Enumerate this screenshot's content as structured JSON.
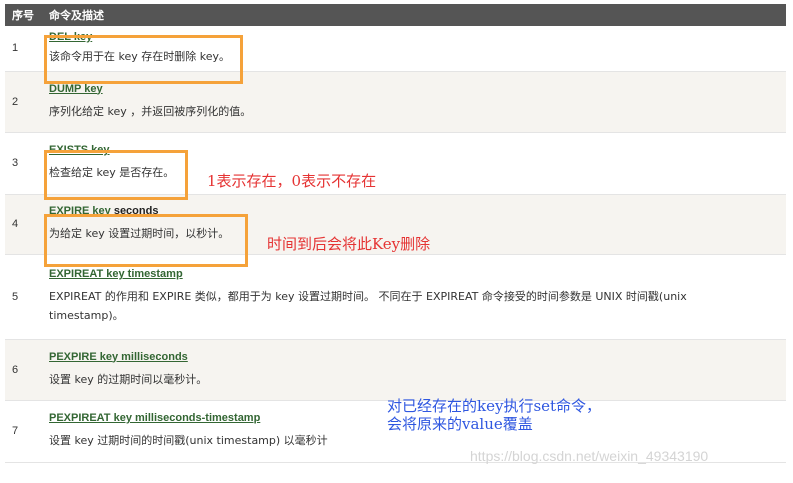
{
  "header": {
    "col_index": "序号",
    "col_command": "命令及描述"
  },
  "rows": [
    {
      "index": "1",
      "command": "DEL key",
      "args": "",
      "description": "该命令用于在 key 存在时删除 key。"
    },
    {
      "index": "2",
      "command": "DUMP key",
      "args": "",
      "description": "序列化给定 key ，并返回被序列化的值。"
    },
    {
      "index": "3",
      "command": "EXISTS key",
      "args": "",
      "description": "检查给定 key 是否存在。"
    },
    {
      "index": "4",
      "command": "EXPIRE key",
      "args": " seconds",
      "description": "为给定 key 设置过期时间，以秒计。"
    },
    {
      "index": "5",
      "command": "EXPIREAT key timestamp",
      "args": "",
      "description": "EXPIREAT 的作用和 EXPIRE 类似，都用于为 key 设置过期时间。 不同在于 EXPIREAT 命令接受的时间参数是 UNIX 时间戳(unix timestamp)。"
    },
    {
      "index": "6",
      "command": "PEXPIRE key milliseconds",
      "args": "",
      "description": "设置 key 的过期时间以毫秒计。"
    },
    {
      "index": "7",
      "command": "PEXPIREAT key milliseconds-timestamp",
      "args": "",
      "description": "设置 key 过期时间的时间戳(unix timestamp) 以毫秒计"
    }
  ],
  "annotations": {
    "exists_note": "1表示存在，0表示不存在",
    "expire_note": "时间到后会将此Key删除",
    "set_note_line1": "对已经存在的key执行set命令，",
    "set_note_line2": "会将原来的value覆盖"
  },
  "watermark": "https://blog.csdn.net/weixin_49343190",
  "colors": {
    "header_bg": "#555555",
    "link": "#336633",
    "highlight_box": "#f5a23a",
    "red_note": "#e53333",
    "blue_note": "#2f57e0"
  }
}
